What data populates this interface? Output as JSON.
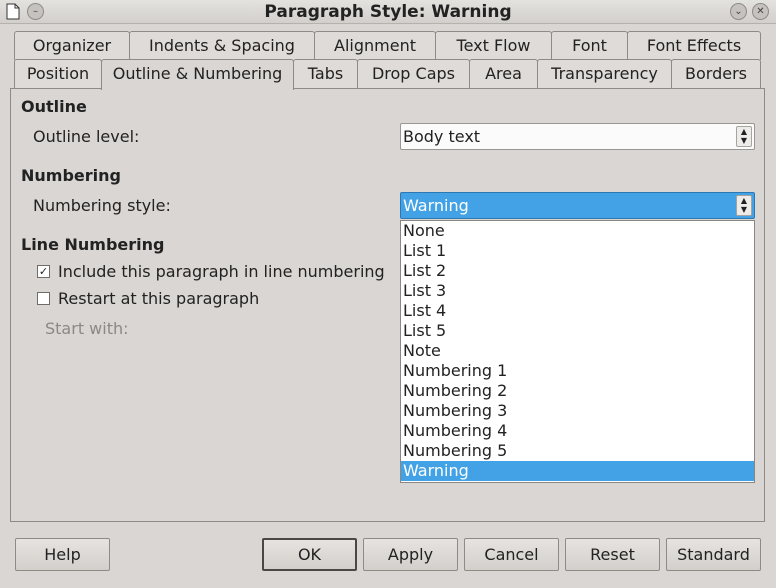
{
  "window": {
    "title": "Paragraph Style: Warning"
  },
  "tabs": {
    "row1": [
      "Organizer",
      "Indents & Spacing",
      "Alignment",
      "Text Flow",
      "Font",
      "Font Effects"
    ],
    "row2": [
      "Position",
      "Outline & Numbering",
      "Tabs",
      "Drop Caps",
      "Area",
      "Transparency",
      "Borders"
    ],
    "active": "Outline & Numbering"
  },
  "outline": {
    "heading": "Outline",
    "level_label": "Outline level:",
    "level_value": "Body text"
  },
  "numbering": {
    "heading": "Numbering",
    "style_label": "Numbering style:",
    "style_value": "Warning",
    "options": [
      "None",
      "List 1",
      "List 2",
      "List 3",
      "List 4",
      "List 5",
      "Note",
      "Numbering 1",
      "Numbering 2",
      "Numbering 3",
      "Numbering 4",
      "Numbering 5",
      "Warning"
    ]
  },
  "line_numbering": {
    "heading": "Line Numbering",
    "include_label": "Include this paragraph in line numbering",
    "include_checked": true,
    "restart_label": "Restart at this paragraph",
    "restart_checked": false,
    "start_with_label": "Start with:"
  },
  "buttons": {
    "help": "Help",
    "ok": "OK",
    "apply": "Apply",
    "cancel": "Cancel",
    "reset": "Reset",
    "standard": "Standard"
  },
  "colors": {
    "selection": "#43a2e6",
    "background": "#d9d6d3"
  }
}
